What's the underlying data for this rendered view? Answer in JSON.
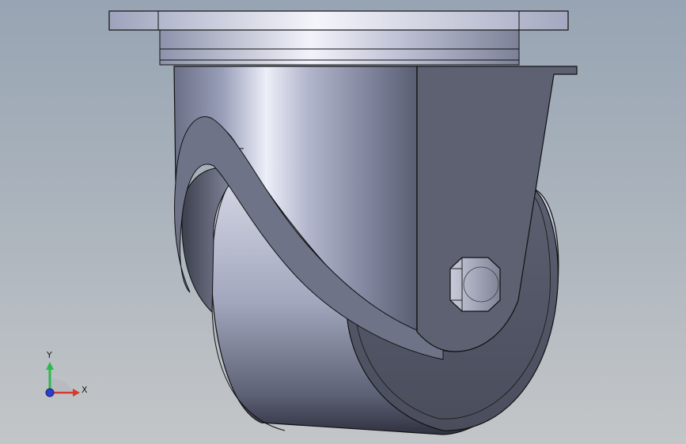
{
  "viewport": {
    "background_top": "#97a4b3",
    "background_bottom": "#c3c6c8"
  },
  "model": {
    "name": "caster-wheel-assembly",
    "parts": [
      "mounting-plate",
      "swivel-housing",
      "fork-leg",
      "wheel",
      "axle-hex-nut"
    ]
  },
  "triad": {
    "y_label": "Y",
    "x_label": "X",
    "y_color": "#2db84a",
    "x_color": "#d23b2f",
    "z_color": "#2a3ecf"
  }
}
